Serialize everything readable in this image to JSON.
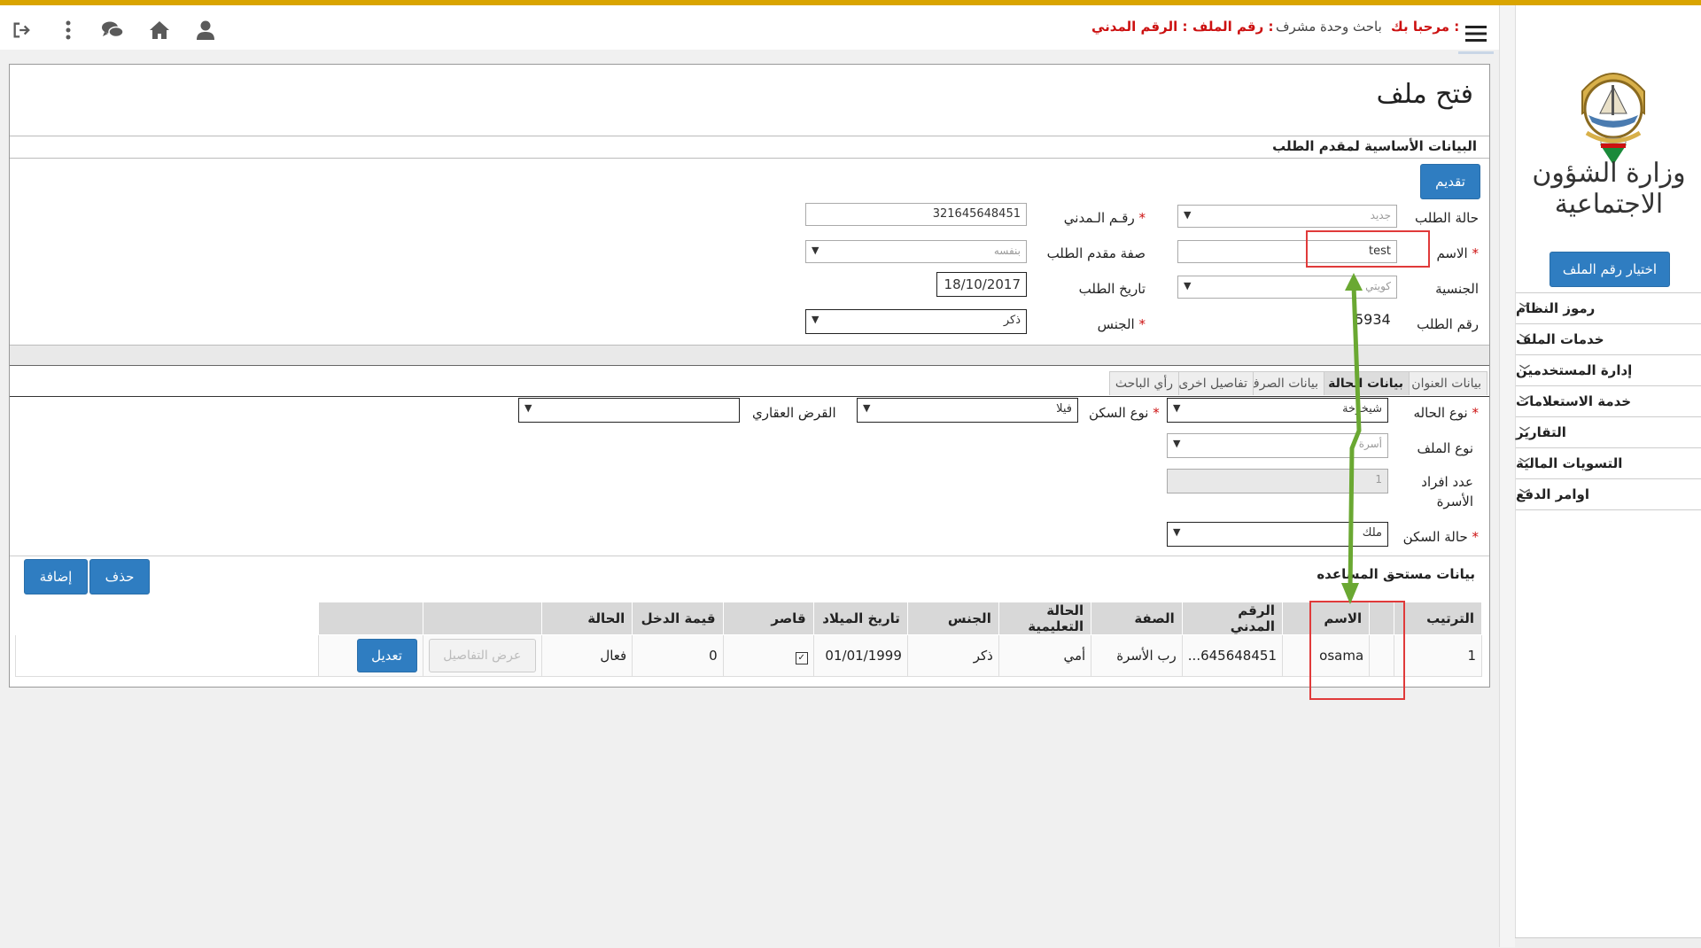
{
  "header": {
    "welcome_label": "مرحبا بك :",
    "welcome_user": "باحث وحدة مشرف",
    "file_number_label": "رقم الملف :",
    "civil_id_label": "الرقم المدني :",
    "icons": [
      "logout-icon",
      "more-vertical-icon",
      "comments-icon",
      "home-icon",
      "user-icon"
    ]
  },
  "sidebar": {
    "ministry_title": "وزارة الشؤون الاجتماعية",
    "select_file_button": "اختيار رقم الملف",
    "menu": [
      "رموز النظام",
      "خدمات الملف",
      "إدارة المستخدمين",
      "خدمة الاستعلامات",
      "التقارير",
      "التسويات المالية",
      "اوامر الدفع"
    ]
  },
  "page": {
    "title": "فتح ملف",
    "section_basic": "البيانات الأساسية لمقدم الطلب",
    "submit_button": "تقديم",
    "form": {
      "request_status_label": "حالة الطلب",
      "request_status_value": "جديد",
      "name_label": "الاسم",
      "name_value": "test",
      "nationality_label": "الجنسية",
      "nationality_value": "كويتي",
      "request_number_label": "رقم الطلب",
      "request_number_value": "5934",
      "civil_id_label": "رقـم الـمدني",
      "civil_id_value": "321645648451",
      "applicant_capacity_label": "صفة مقدم الطلب",
      "applicant_capacity_value": "بنفسه",
      "request_date_label": "تاريخ الطلب",
      "request_date_value": "18/10/2017",
      "gender_label": "الجنس",
      "gender_value": "ذكر"
    },
    "tabs": [
      "بيانات العنوان",
      "بيانات الحالة",
      "بيانات الصرف",
      "تفاصيل اخرى",
      "رأي الباحث"
    ],
    "case": {
      "case_type_label": "نوع الحاله",
      "case_type_value": "شيخوخة",
      "housing_type_label": "نوع السكن",
      "housing_type_value": "فيلا",
      "real_estate_loan_label": "القرض العقاري",
      "real_estate_loan_value": "",
      "file_type_label": "نوع الملف",
      "file_type_value": "أسرة",
      "family_count_label": "عدد افراد الأسرة",
      "family_count_value": "1",
      "housing_status_label": "حالة السكن",
      "housing_status_value": "ملك"
    },
    "beneficiary_section": "بيانات مستحق المساعده",
    "delete_button": "حذف",
    "add_button": "إضافة",
    "table": {
      "headers": [
        "الترتيب",
        "",
        "الاسم",
        "الرقم المدني",
        "الصفة",
        "الحالة التعليمية",
        "الجنس",
        "تاريخ الميلاد",
        "قاصر",
        "قيمة الدخل",
        "الحالة",
        "",
        ""
      ],
      "row": {
        "order": "1",
        "name": "osama",
        "civil_id": "645648451...",
        "capacity": "رب الأسرة",
        "education": "أمي",
        "gender": "ذكر",
        "birth_date": "01/01/1999",
        "minor_checked": "✓",
        "income": "0",
        "status": "فعال",
        "details_button": "عرض التفاصيل",
        "edit_button": "تعديل"
      }
    }
  }
}
